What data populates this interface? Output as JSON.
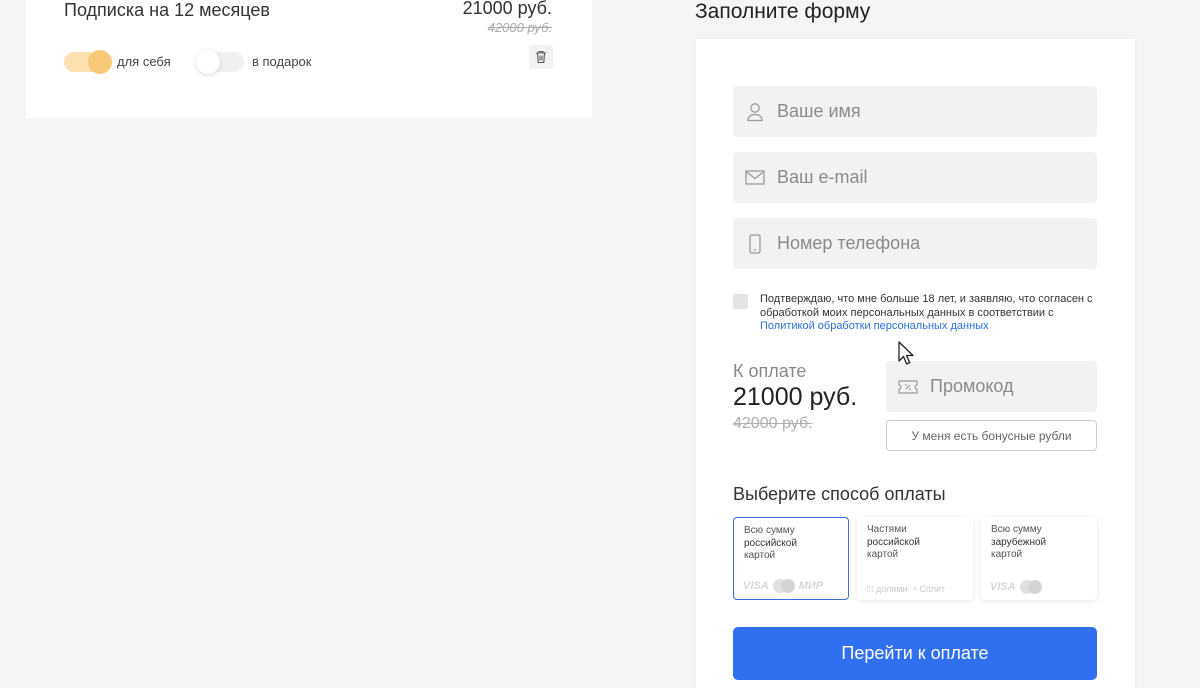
{
  "cart": {
    "item_title": "Подписка на 12 месяцев",
    "price": "21000 руб.",
    "old_price": "42000 руб.",
    "toggle_self_label": "для себя",
    "toggle_self_on": true,
    "toggle_gift_label": "в подарок",
    "toggle_gift_on": false
  },
  "form": {
    "title": "Заполните форму",
    "name_placeholder": "Ваше имя",
    "email_placeholder": "Ваш e-mail",
    "phone_placeholder": "Номер телефона",
    "consent_text": "Подтверждаю, что мне больше 18 лет, и заявляю, что согласен с обработкой моих персональных данных в соответствии с ",
    "consent_link": "Политикой обработки персональных данных",
    "pay_label": "К оплате",
    "pay_amount": "21000 руб.",
    "pay_old": "42000 руб.",
    "promo_placeholder": "Промокод",
    "bonus_button": "У меня есть бонусные рубли",
    "method_title": "Выберите способ оплаты",
    "methods": [
      {
        "line1": "Всю сумму",
        "line2": "российской",
        "line3": "картой",
        "logos": [
          "VISA",
          "MasterCard",
          "МИР"
        ],
        "selected": true
      },
      {
        "line1": "Частями",
        "line2": "российской",
        "line3": "картой",
        "logos": [
          "долями",
          "Сплит"
        ],
        "selected": false
      },
      {
        "line1": "Всю сумму",
        "line2": "зарубежной",
        "line3": "картой",
        "logos": [
          "VISA",
          "MasterCard"
        ],
        "selected": false
      }
    ],
    "submit_button": "Перейти к оплате"
  },
  "colors": {
    "accent": "#2f6ff0",
    "link": "#2a6fdb",
    "toggle_on": "#f9c97a"
  }
}
